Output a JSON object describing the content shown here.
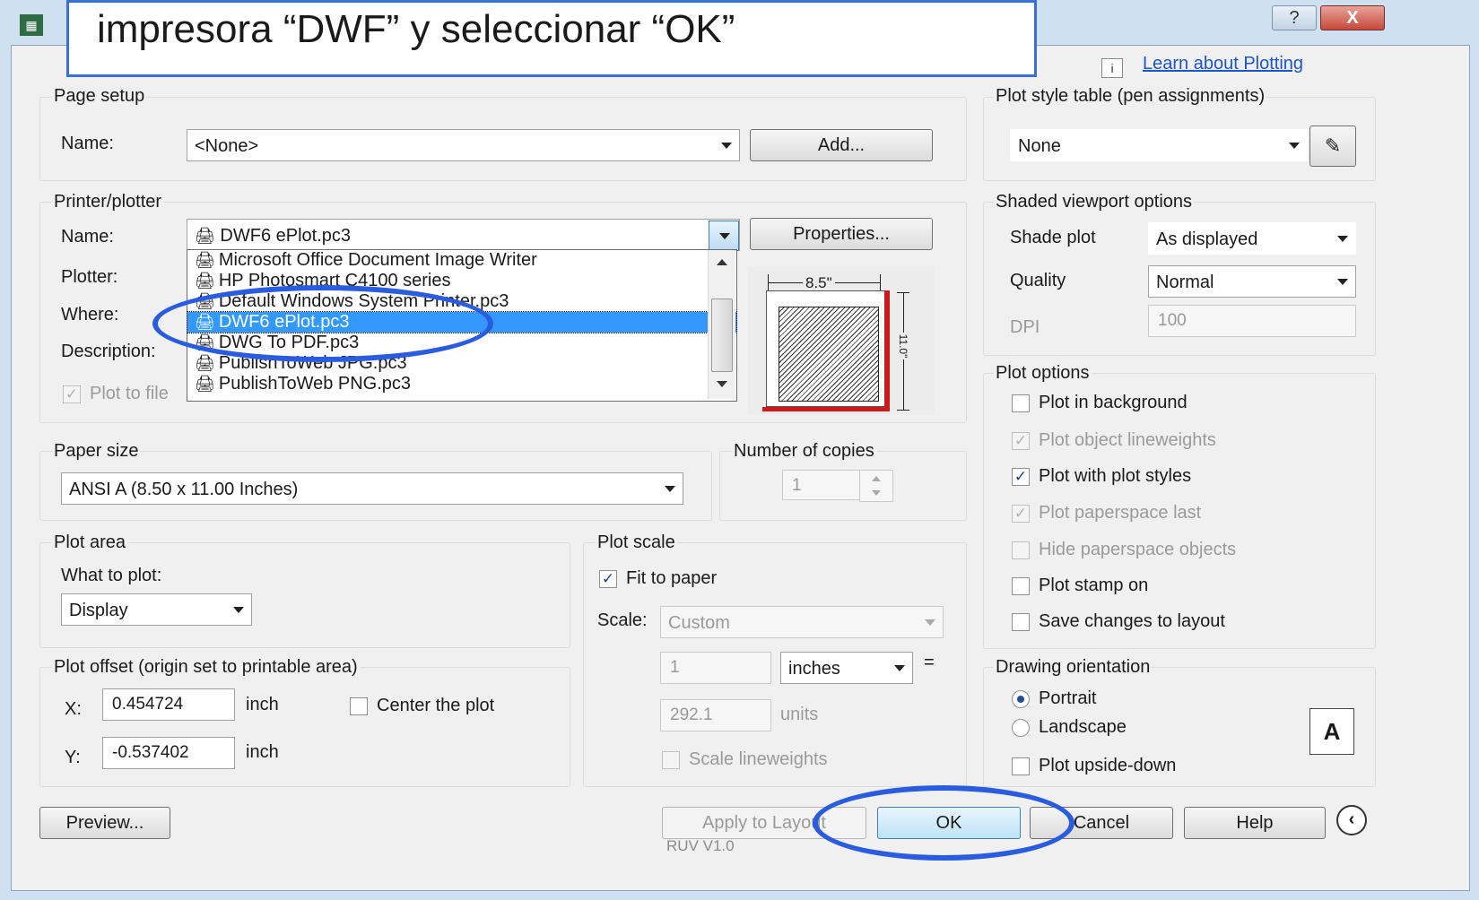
{
  "overlay": {
    "caption": "impresora “DWF” y seleccionar “OK”"
  },
  "titlebar": {
    "help_glyph": "?",
    "close_glyph": "X"
  },
  "learn_link": "Learn about Plotting",
  "page_setup": {
    "group": "Page setup",
    "name_label": "Name:",
    "name_value": "<None>",
    "add_button": "Add..."
  },
  "printer": {
    "group": "Printer/plotter",
    "name_label": "Name:",
    "name_value": "DWF6 ePlot.pc3",
    "properties_button": "Properties...",
    "plotter_label": "Plotter:",
    "where_label": "Where:",
    "description_label": "Description:",
    "plot_to_file": "Plot to file",
    "dropdown_items": [
      "Microsoft Office Document Image Writer",
      "HP Photosmart C4100 series",
      "Default Windows System Printer.pc3",
      "DWF6 ePlot.pc3",
      "DWG To PDF.pc3",
      "PublishToWeb JPG.pc3",
      "PublishToWeb PNG.pc3"
    ],
    "preview_width_label": "8.5\"",
    "preview_height_label": "11.0\""
  },
  "paper_size": {
    "group": "Paper size",
    "value": "ANSI A (8.50 x 11.00 Inches)"
  },
  "copies": {
    "group": "Number of copies",
    "value": "1"
  },
  "plot_area": {
    "group": "Plot area",
    "what_label": "What to plot:",
    "value": "Display"
  },
  "plot_offset": {
    "group": "Plot offset (origin set to printable area)",
    "x_label": "X:",
    "x_value": "0.454724",
    "x_unit": "inch",
    "y_label": "Y:",
    "y_value": "-0.537402",
    "y_unit": "inch",
    "center_label": "Center the plot"
  },
  "plot_scale": {
    "group": "Plot scale",
    "fit_label": "Fit to paper",
    "scale_label": "Scale:",
    "scale_value": "Custom",
    "value1": "1",
    "unit1": "inches",
    "equals": "=",
    "value2": "292.1",
    "unit2": "units",
    "lineweights_label": "Scale lineweights"
  },
  "plot_style_table": {
    "group": "Plot style table (pen assignments)",
    "value": "None"
  },
  "shaded": {
    "group": "Shaded viewport options",
    "shade_label": "Shade plot",
    "shade_value": "As displayed",
    "quality_label": "Quality",
    "quality_value": "Normal",
    "dpi_label": "DPI",
    "dpi_value": "100"
  },
  "plot_options": {
    "group": "Plot options",
    "items": [
      {
        "label": "Plot in background",
        "checked": false,
        "enabled": true
      },
      {
        "label": "Plot object lineweights",
        "checked": true,
        "enabled": false
      },
      {
        "label": "Plot with plot styles",
        "checked": true,
        "enabled": true
      },
      {
        "label": "Plot paperspace last",
        "checked": true,
        "enabled": false
      },
      {
        "label": "Hide paperspace objects",
        "checked": false,
        "enabled": false
      },
      {
        "label": "Plot stamp on",
        "checked": false,
        "enabled": true
      },
      {
        "label": "Save changes to layout",
        "checked": false,
        "enabled": true
      }
    ]
  },
  "orientation": {
    "group": "Drawing orientation",
    "portrait": "Portrait",
    "landscape": "Landscape",
    "upside_down": "Plot upside-down",
    "icon_letter": "A"
  },
  "footer": {
    "preview": "Preview...",
    "apply": "Apply to Layout",
    "ok": "OK",
    "cancel": "Cancel",
    "help": "Help",
    "watermark": "RUV V1.0"
  }
}
